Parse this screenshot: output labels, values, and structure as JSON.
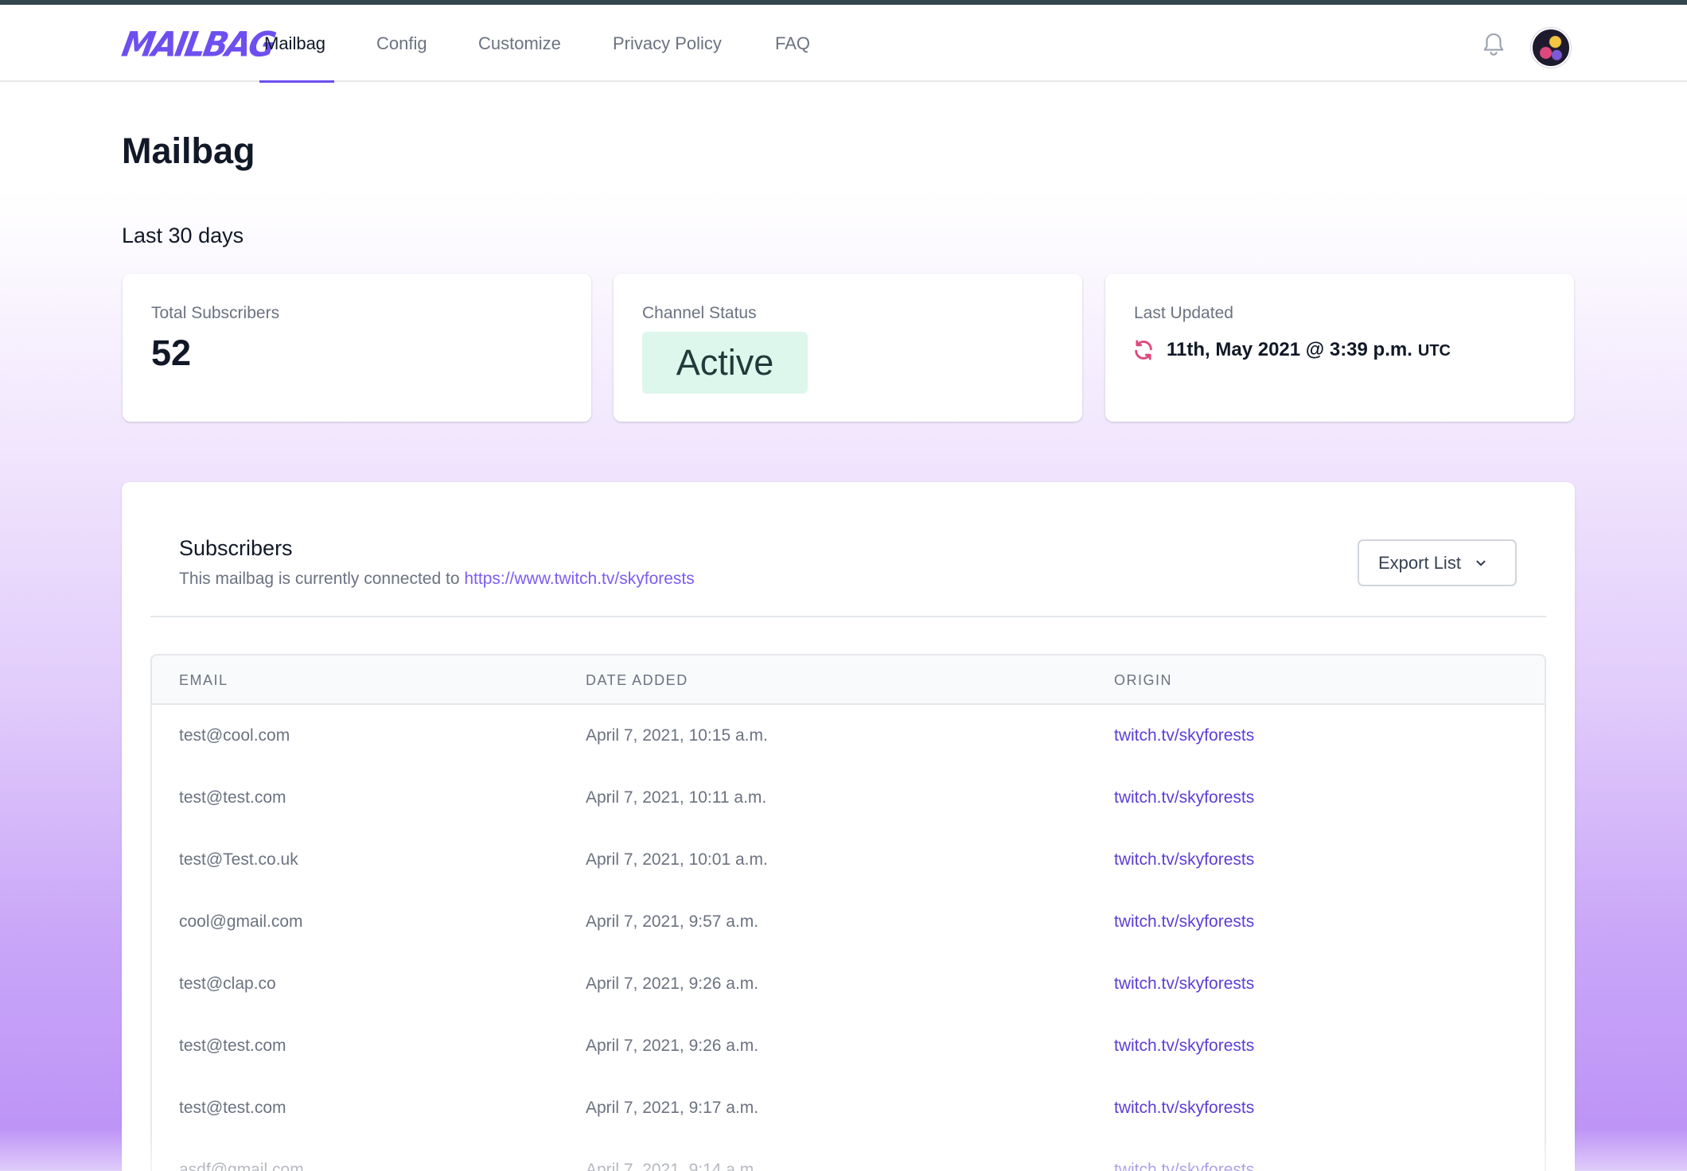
{
  "app": {
    "logo": "MAILBAG"
  },
  "nav": {
    "items": [
      {
        "label": "Mailbag",
        "active": true
      },
      {
        "label": "Config",
        "active": false
      },
      {
        "label": "Customize",
        "active": false
      },
      {
        "label": "Privacy Policy",
        "active": false
      },
      {
        "label": "FAQ",
        "active": false
      }
    ],
    "icons": [
      "bell-icon",
      "avatar"
    ]
  },
  "page": {
    "title": "Mailbag",
    "period": "Last 30 days"
  },
  "stats": {
    "total_subscribers": {
      "label": "Total Subscribers",
      "value": "52"
    },
    "channel_status": {
      "label": "Channel Status",
      "value": "Active"
    },
    "last_updated": {
      "label": "Last Updated",
      "value": "11th, May 2021 @ 3:39 p.m.",
      "tz": "UTC"
    }
  },
  "subscribers": {
    "title": "Subscribers",
    "desc_prefix": "This mailbag is currently connected to ",
    "channel_url": "https://www.twitch.tv/skyforests",
    "export_label": "Export List",
    "columns": [
      "Email",
      "Date Added",
      "Origin"
    ],
    "rows": [
      {
        "email": "test@cool.com",
        "date": "April 7, 2021, 10:15 a.m.",
        "origin": "twitch.tv/skyforests"
      },
      {
        "email": "test@test.com",
        "date": "April 7, 2021, 10:11 a.m.",
        "origin": "twitch.tv/skyforests"
      },
      {
        "email": "test@Test.co.uk",
        "date": "April 7, 2021, 10:01 a.m.",
        "origin": "twitch.tv/skyforests"
      },
      {
        "email": "cool@gmail.com",
        "date": "April 7, 2021, 9:57 a.m.",
        "origin": "twitch.tv/skyforests"
      },
      {
        "email": "test@clap.co",
        "date": "April 7, 2021, 9:26 a.m.",
        "origin": "twitch.tv/skyforests"
      },
      {
        "email": "test@test.com",
        "date": "April 7, 2021, 9:26 a.m.",
        "origin": "twitch.tv/skyforests"
      },
      {
        "email": "test@test.com",
        "date": "April 7, 2021, 9:17 a.m.",
        "origin": "twitch.tv/skyforests"
      },
      {
        "email": "asdf@gmail.com",
        "date": "April 7, 2021, 9:14 a.m.",
        "origin": "twitch.tv/skyforests"
      }
    ]
  },
  "colors": {
    "accent": "#6d4ff0",
    "link": "#5b3fd6",
    "status_bg": "#def7ec",
    "refresh_icon": "#e0487d"
  }
}
